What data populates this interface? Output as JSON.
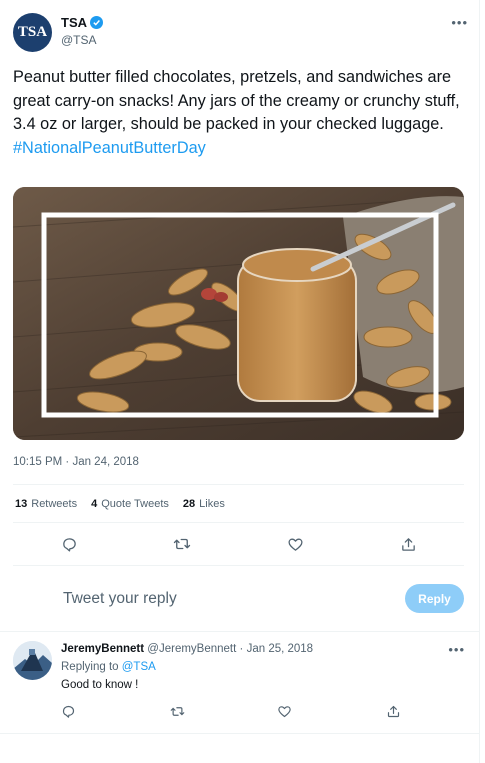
{
  "tweet": {
    "author": {
      "name": "TSA",
      "handle": "@TSA",
      "avatar_text": "TSA",
      "verified_icon": "verified-badge-icon"
    },
    "more_icon": "more-icon",
    "text": "Peanut butter filled chocolates, pretzels, and sandwiches are great carry-on snacks! Any jars of the creamy or crunchy stuff, 3.4 oz or larger, should be packed in your checked luggage.",
    "hashtag": "#NationalPeanutButterDay",
    "media_icon": "peanut-butter-photo",
    "timestamp": "10:15 PM · Jan 24, 2018",
    "stats": {
      "retweets_count": "13",
      "retweets_label": "Retweets",
      "quotes_count": "4",
      "quotes_label": "Quote Tweets",
      "likes_count": "28",
      "likes_label": "Likes"
    },
    "actions": [
      "reply-icon",
      "retweet-icon",
      "like-icon",
      "share-icon"
    ]
  },
  "composer": {
    "placeholder": "Tweet your reply",
    "button_label": "Reply"
  },
  "replies": [
    {
      "name": "JeremyBennett",
      "handle": "@JeremyBennett",
      "date": "Jan 25, 2018",
      "replying_prefix": "Replying to",
      "replying_to": "@TSA",
      "text": "Good to know !"
    }
  ],
  "colors": {
    "accent": "#1d9bf0",
    "reply_button": "#8ecdf8",
    "secondary_text": "#536471",
    "avatar_tsa": "#1c3f6e"
  }
}
